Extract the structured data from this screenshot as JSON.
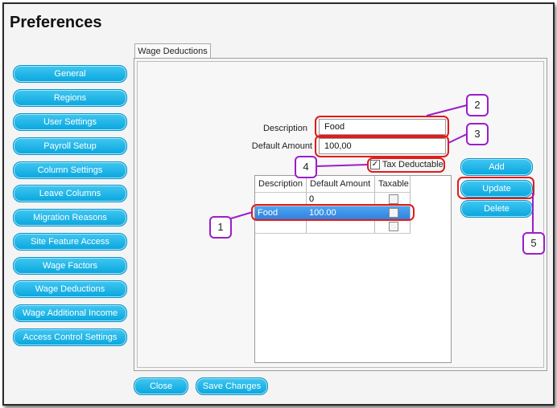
{
  "window": {
    "title": "Preferences"
  },
  "sidebar": {
    "items": [
      {
        "label": "General"
      },
      {
        "label": "Regions"
      },
      {
        "label": "User Settings"
      },
      {
        "label": "Payroll Setup"
      },
      {
        "label": "Column Settings"
      },
      {
        "label": "Leave Columns"
      },
      {
        "label": "Migration Reasons"
      },
      {
        "label": "Site Feature Access"
      },
      {
        "label": "Wage Factors"
      },
      {
        "label": "Wage Deductions"
      },
      {
        "label": "Wage Additional Income"
      },
      {
        "label": "Access Control Settings"
      }
    ]
  },
  "tab": {
    "label": "Wage Deductions"
  },
  "form": {
    "description_label": "Description",
    "description_value": "Food",
    "amount_label": "Default Amount",
    "amount_value": "100,00",
    "tax_label": "Tax Deductable",
    "tax_checked": "✓"
  },
  "grid": {
    "headers": [
      "Description",
      "Default Amount",
      "Taxable"
    ],
    "rows": [
      {
        "description": "",
        "amount": "0",
        "taxable": false
      },
      {
        "description": "Food",
        "amount": "100.00",
        "taxable": false,
        "selected": true
      },
      {
        "description": "",
        "amount": "",
        "taxable": false
      }
    ]
  },
  "actions": {
    "add": "Add",
    "update": "Update",
    "delete": "Delete"
  },
  "footer": {
    "close": "Close",
    "save": "Save Changes"
  },
  "callouts": [
    "1",
    "2",
    "3",
    "4",
    "5"
  ],
  "colors": {
    "accent": "#09a6de",
    "highlight": "#e21b1b",
    "callout": "#9b1ec9",
    "selection": "#3a8fe6"
  }
}
